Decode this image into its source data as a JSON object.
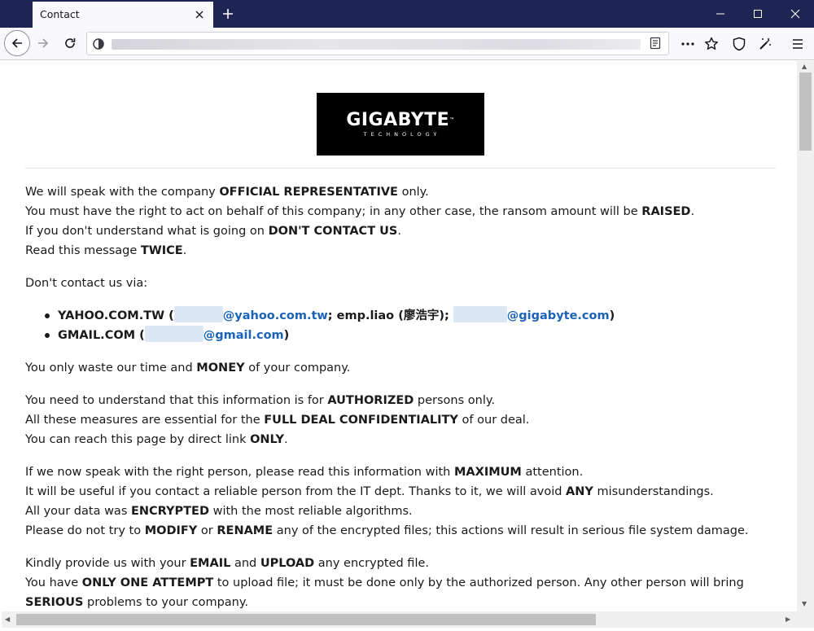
{
  "browser": {
    "tab_title": "Contact",
    "colors": {
      "titlebar": "#1f2552",
      "link": "#1a63b8"
    }
  },
  "logo": {
    "text": "GIGABYTE",
    "tm": "™",
    "sub": "TECHNOLOGY"
  },
  "content": {
    "p1": {
      "l1a": "We will speak with the company ",
      "l1b": "OFFICIAL REPRESENTATIVE",
      "l1c": " only.",
      "l2a": "You must have the right to act on behalf of this company; in any other case, the ransom amount will be ",
      "l2b": "RAISED",
      "l2c": ".",
      "l3a": "If you don't understand what is going on ",
      "l3b": "DON'T CONTACT US",
      "l3c": ".",
      "l4a": "Read this message ",
      "l4b": "TWICE",
      "l4c": "."
    },
    "p2": "Don't contact us via:",
    "contacts": {
      "c1_label": "YAHOO.COM.TW (",
      "c1_mail": "@yahoo.com.tw",
      "c1_mid": "; emp.liao (廖浩宇); ",
      "c1_mail2": "@gigabyte.com",
      "c1_end": ")",
      "c2_label": "GMAIL.COM (",
      "c2_mail": "@gmail.com",
      "c2_end": ")"
    },
    "p3": {
      "a": "You only waste our time and ",
      "b": "MONEY",
      "c": " of your company."
    },
    "p4": {
      "l1a": "You need to understand that this information is for ",
      "l1b": "AUTHORIZED",
      "l1c": " persons only.",
      "l2a": "All these measures are essential for the ",
      "l2b": "FULL DEAL CONFIDENTIALITY",
      "l2c": " of our deal.",
      "l3a": "You can reach this page by direct link ",
      "l3b": "ONLY",
      "l3c": "."
    },
    "p5": {
      "l1a": "If we now speak with the right person, please read this information with ",
      "l1b": "MAXIMUM",
      "l1c": " attention.",
      "l2a": "It will be useful if you contact a reliable person from the IT dept. Thanks to it, we will avoid ",
      "l2b": "ANY",
      "l2c": " misunderstandings.",
      "l3a": "All your data was ",
      "l3b": "ENCRYPTED",
      "l3c": " with the most reliable algorithms.",
      "l4a": "Please do not try to ",
      "l4b": "MODIFY",
      "l4c": " or ",
      "l4d": "RENAME",
      "l4e": " any of the encrypted files; this actions will result in serious file system damage."
    },
    "p6": {
      "l1a": "Kindly provide us with your ",
      "l1b": "EMAIL",
      "l1c": " and ",
      "l1d": "UPLOAD",
      "l1e": " any encrypted file.",
      "l2a": "You have ",
      "l2b": "ONLY ONE ATTEMPT",
      "l2c": " to upload file; it must be done only by the authorized person. Any other person will bring ",
      "l2d": "SERIOUS",
      "l2e": " problems to your company."
    }
  }
}
